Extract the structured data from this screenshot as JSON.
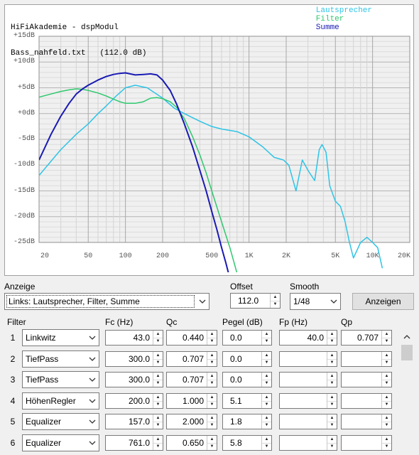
{
  "chart": {
    "title_line1": "HiFiAkademie - dspModul",
    "title_line2": "Bass_nahfeld.txt   (112.0 dB)",
    "legend": [
      {
        "name": "Lautsprecher",
        "color": "#2ec4e6"
      },
      {
        "name": "Filter",
        "color": "#2ec86e"
      },
      {
        "name": "Summe",
        "color": "#1a1ab4"
      }
    ],
    "y_ticks": [
      "+15dB",
      "+10dB",
      "+5dB",
      "+0dB",
      "-5dB",
      "-10dB",
      "-15dB",
      "-20dB",
      "-25dB"
    ],
    "x_ticks": [
      "20",
      "50",
      "100",
      "200",
      "500",
      "1K",
      "2K",
      "5K",
      "10K",
      "20K"
    ]
  },
  "chart_data": {
    "type": "line",
    "x_scale": "log",
    "xlim": [
      20,
      20000
    ],
    "ylim": [
      -25,
      15
    ],
    "grid": true,
    "legend_position": "top-right",
    "series": [
      {
        "name": "Lautsprecher",
        "color": "#2ec4e6",
        "x": [
          20,
          30,
          40,
          50,
          60,
          70,
          85,
          100,
          120,
          150,
          200,
          250,
          300,
          400,
          500,
          600,
          800,
          1000,
          1300,
          1600,
          1900,
          2100,
          2400,
          2700,
          3000,
          3400,
          3700,
          3900,
          4200,
          4500,
          5000,
          5500,
          6000,
          6500,
          7000,
          8000,
          9000,
          10000,
          11000,
          12000
        ],
        "y": [
          -12,
          -7,
          -4,
          -2,
          0,
          1.5,
          3.5,
          5,
          5.5,
          5,
          3,
          1,
          0,
          -1.5,
          -2.5,
          -3,
          -3.5,
          -4.5,
          -6.5,
          -8.5,
          -9,
          -10,
          -15,
          -9,
          -11,
          -13,
          -7,
          -6,
          -7.5,
          -14,
          -17,
          -18,
          -21,
          -25,
          -28,
          -25,
          -24,
          -25,
          -26,
          -30
        ]
      },
      {
        "name": "Filter",
        "color": "#2ec86e",
        "x": [
          20,
          25,
          30,
          35,
          40,
          45,
          50,
          60,
          70,
          80,
          90,
          100,
          120,
          140,
          160,
          180,
          200,
          230,
          260,
          300,
          350,
          400,
          450,
          500,
          600,
          700,
          800,
          900,
          1000
        ],
        "y": [
          3.2,
          3.8,
          4.3,
          4.6,
          4.8,
          4.7,
          4.5,
          4,
          3.4,
          2.8,
          2.3,
          2,
          2,
          2.3,
          3,
          3.1,
          2.9,
          2.3,
          1.2,
          -1,
          -4.5,
          -8,
          -11.5,
          -15,
          -21,
          -26,
          -31,
          -34,
          -38
        ]
      },
      {
        "name": "Summe",
        "color": "#1a1ab4",
        "x": [
          20,
          25,
          30,
          35,
          40,
          45,
          50,
          60,
          70,
          80,
          90,
          100,
          120,
          140,
          160,
          180,
          200,
          230,
          260,
          300,
          350,
          400,
          450,
          500,
          550,
          600,
          650,
          700,
          800
        ],
        "y": [
          -9,
          -4,
          -0.5,
          2,
          3.8,
          4.8,
          5.5,
          6.5,
          7.2,
          7.6,
          7.8,
          7.9,
          7.5,
          7.6,
          7.7,
          7.5,
          6.5,
          4.5,
          1.8,
          -2,
          -6.5,
          -11,
          -15,
          -19,
          -22.5,
          -26,
          -29,
          -32,
          -38
        ]
      }
    ]
  },
  "controls": {
    "anzeige_label": "Anzeige",
    "anzeige_value": "Links: Lautsprecher, Filter, Summe",
    "offset_label": "Offset",
    "offset_value": "112.0",
    "smooth_label": "Smooth",
    "smooth_value": "1/48",
    "anzeigen_button": "Anzeigen"
  },
  "filter_table": {
    "headers": {
      "filter": "Filter",
      "fc": "Fc (Hz)",
      "qc": "Qc",
      "pegel": "Pegel (dB)",
      "fp": "Fp (Hz)",
      "qp": "Qp"
    },
    "rows": [
      {
        "num": "1",
        "type": "Linkwitz",
        "fc": "43.0",
        "qc": "0.440",
        "pegel": "0.0",
        "fp": "40.0",
        "qp": "0.707"
      },
      {
        "num": "2",
        "type": "TiefPass",
        "fc": "300.0",
        "qc": "0.707",
        "pegel": "0.0",
        "fp": "",
        "qp": ""
      },
      {
        "num": "3",
        "type": "TiefPass",
        "fc": "300.0",
        "qc": "0.707",
        "pegel": "0.0",
        "fp": "",
        "qp": ""
      },
      {
        "num": "4",
        "type": "HöhenRegler",
        "fc": "200.0",
        "qc": "1.000",
        "pegel": "5.1",
        "fp": "",
        "qp": ""
      },
      {
        "num": "5",
        "type": "Equalizer",
        "fc": "157.0",
        "qc": "2.000",
        "pegel": "1.8",
        "fp": "",
        "qp": ""
      },
      {
        "num": "6",
        "type": "Equalizer",
        "fc": "761.0",
        "qc": "0.650",
        "pegel": "5.8",
        "fp": "",
        "qp": ""
      }
    ]
  },
  "icons": {
    "dropdown": "chevron-down-icon",
    "spin_up": "triangle-up-icon",
    "spin_down": "triangle-down-icon",
    "scroll_up": "chevron-up-icon"
  }
}
